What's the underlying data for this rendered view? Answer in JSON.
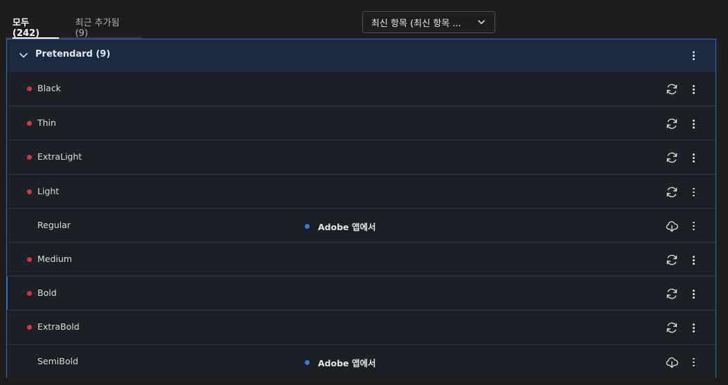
{
  "tabs": [
    {
      "label": "모두 (242)",
      "active": true
    },
    {
      "label": "최근 추가됨 (9)",
      "active": false
    }
  ],
  "sort_dropdown": {
    "label": "최신 항목 (최신 항목 ...",
    "icon": "chevron-down-icon"
  },
  "group": {
    "title": "Pretendard (9)",
    "icon": "chevron-down-icon"
  },
  "fonts": [
    {
      "name": "Black",
      "status": "active",
      "source": "",
      "action_icon": "sync-icon"
    },
    {
      "name": "Thin",
      "status": "active",
      "source": "",
      "action_icon": "sync-icon"
    },
    {
      "name": "ExtraLight",
      "status": "active",
      "source": "",
      "action_icon": "sync-icon"
    },
    {
      "name": "Light",
      "status": "active",
      "source": "",
      "action_icon": "sync-icon"
    },
    {
      "name": "Regular",
      "status": "none",
      "source": "Adobe 앱에서",
      "action_icon": "cloud-download-icon"
    },
    {
      "name": "Medium",
      "status": "active",
      "source": "",
      "action_icon": "sync-icon"
    },
    {
      "name": "Bold",
      "status": "active",
      "source": "",
      "action_icon": "sync-icon",
      "selected": true
    },
    {
      "name": "ExtraBold",
      "status": "active",
      "source": "",
      "action_icon": "sync-icon"
    },
    {
      "name": "SemiBold",
      "status": "none",
      "source": "Adobe 앱에서",
      "action_icon": "cloud-download-icon"
    }
  ],
  "colors": {
    "accent": "#2d6fd6",
    "active_dot": "#d9363e",
    "source_dot": "#2e7be6"
  }
}
